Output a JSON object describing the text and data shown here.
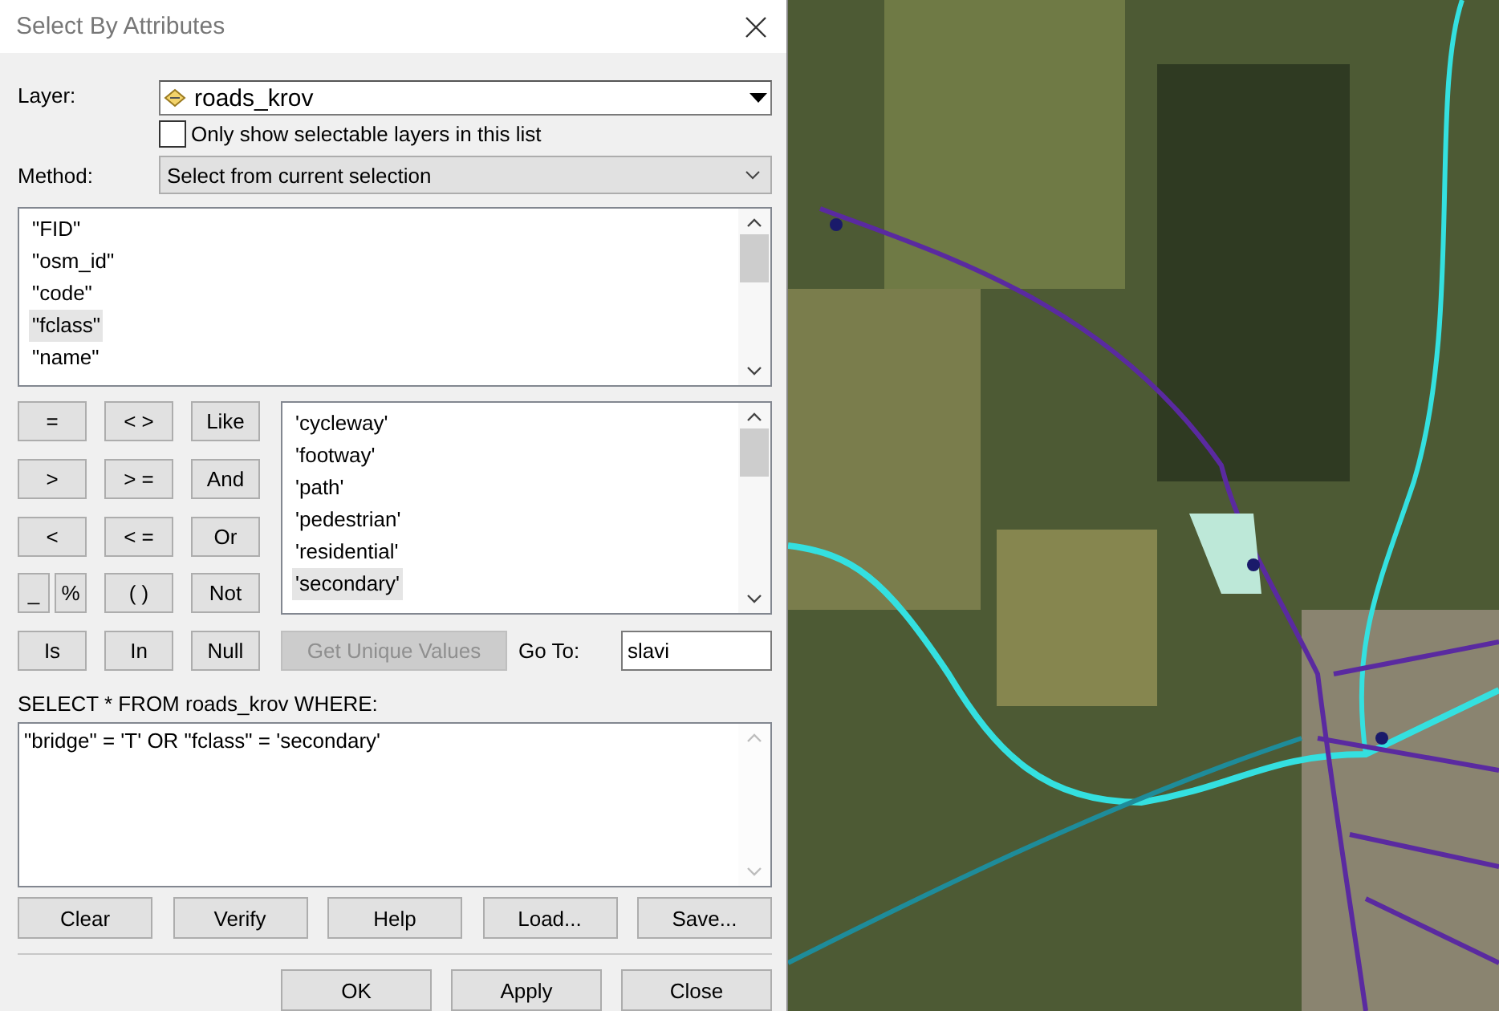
{
  "window": {
    "title": "Select By Attributes"
  },
  "layer": {
    "label": "Layer:",
    "value": "roads_krov"
  },
  "selectable_only": {
    "label": "Only show selectable layers in this list",
    "checked": false
  },
  "method": {
    "label": "Method:",
    "value": "Select from current selection"
  },
  "fields": [
    {
      "label": "\"FID\"",
      "selected": false
    },
    {
      "label": "\"osm_id\"",
      "selected": false
    },
    {
      "label": "\"code\"",
      "selected": false
    },
    {
      "label": "\"fclass\"",
      "selected": true
    },
    {
      "label": "\"name\"",
      "selected": false
    }
  ],
  "operators": [
    [
      {
        "label": "=",
        "kind": "full"
      },
      {
        "label": "< >",
        "kind": "full"
      },
      {
        "label": "Like",
        "kind": "full"
      }
    ],
    [
      {
        "label": ">",
        "kind": "full"
      },
      {
        "label": "> =",
        "kind": "full"
      },
      {
        "label": "And",
        "kind": "full"
      }
    ],
    [
      {
        "label": "<",
        "kind": "full"
      },
      {
        "label": "< =",
        "kind": "full"
      },
      {
        "label": "Or",
        "kind": "full"
      }
    ],
    [
      {
        "label": "_",
        "kind": "half"
      },
      {
        "label": "%",
        "kind": "half"
      },
      {
        "label": "( )",
        "kind": "full"
      },
      {
        "label": "Not",
        "kind": "full"
      }
    ],
    [
      {
        "label": "Is",
        "kind": "full"
      },
      {
        "label": "In",
        "kind": "full"
      },
      {
        "label": "Null",
        "kind": "full"
      }
    ]
  ],
  "values": [
    {
      "label": "'cycleway'",
      "selected": false
    },
    {
      "label": "'footway'",
      "selected": false
    },
    {
      "label": "'path'",
      "selected": false
    },
    {
      "label": "'pedestrian'",
      "selected": false
    },
    {
      "label": "'residential'",
      "selected": false
    },
    {
      "label": "'secondary'",
      "selected": true
    }
  ],
  "get_unique_values": {
    "label": "Get Unique Values",
    "disabled": true
  },
  "go_to": {
    "label": "Go To:",
    "value": "slavi"
  },
  "sql_label": "SELECT * FROM roads_krov WHERE:",
  "expression": "\"bridge\" = 'T' OR \"fclass\" = 'secondary'",
  "expression_buttons": [
    "Clear",
    "Verify",
    "Help",
    "Load...",
    "Save..."
  ],
  "dialog_buttons": [
    "OK",
    "Apply",
    "Close"
  ]
}
